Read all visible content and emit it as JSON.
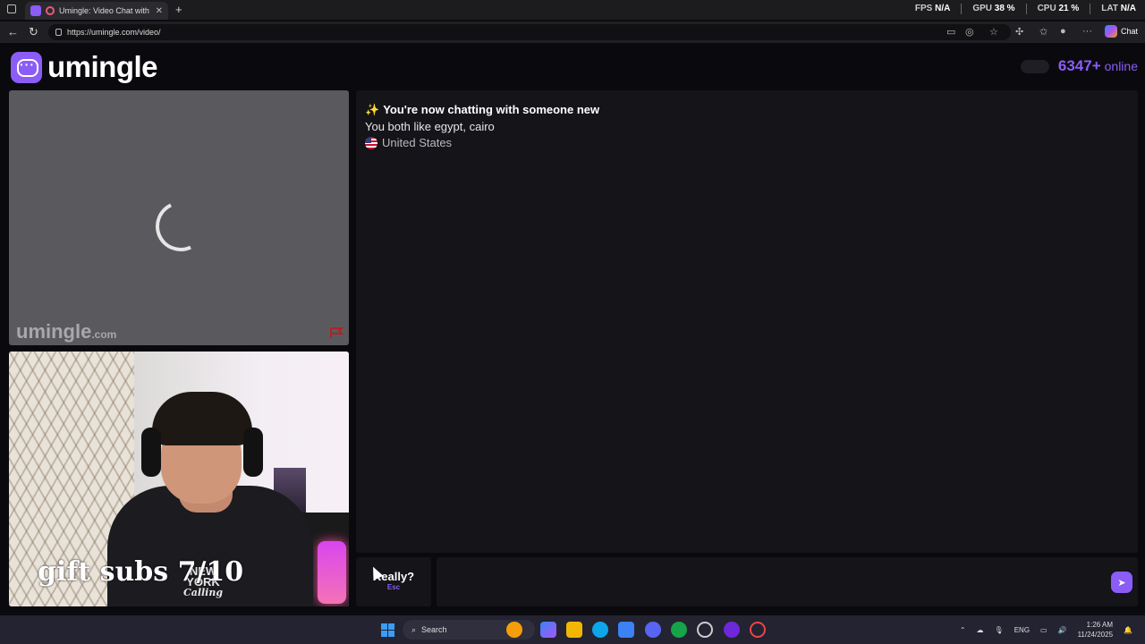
{
  "browser": {
    "tab_title": "Umingle: Video Chat with St",
    "url": "https://umingle.com/video/",
    "chat_label": "Chat"
  },
  "hud": {
    "fps_label": "FPS",
    "fps_value": "N/A",
    "gpu_label": "GPU",
    "gpu_value": "38 %",
    "cpu_label": "CPU",
    "cpu_value": "21 %",
    "lat_label": "LAT",
    "lat_value": "N/A"
  },
  "header": {
    "logo_text": "umingle",
    "online_count": "6347+",
    "online_label": "online"
  },
  "stranger_video": {
    "watermark": "umingle",
    "watermark_suffix": ".com"
  },
  "self_video": {
    "hoodie_text_line1": "NEW YORK",
    "hoodie_text_line2": "Calling"
  },
  "overlay": {
    "stream_caption": "gift subs 7/10"
  },
  "chat": {
    "new_chat_message": "You're now chatting with someone new",
    "shared_interests": "You both like egypt, cairo",
    "country": "United States"
  },
  "controls": {
    "skip_label": "Really?",
    "skip_key": "Esc",
    "message_placeholder": ""
  },
  "taskbar": {
    "search_label": "Search",
    "language": "ENG",
    "time": "1:26 AM",
    "date": "11/24/2025"
  },
  "colors": {
    "accent": "#8b5cf6",
    "background": "#0a0a0e",
    "panel": "#141419"
  }
}
